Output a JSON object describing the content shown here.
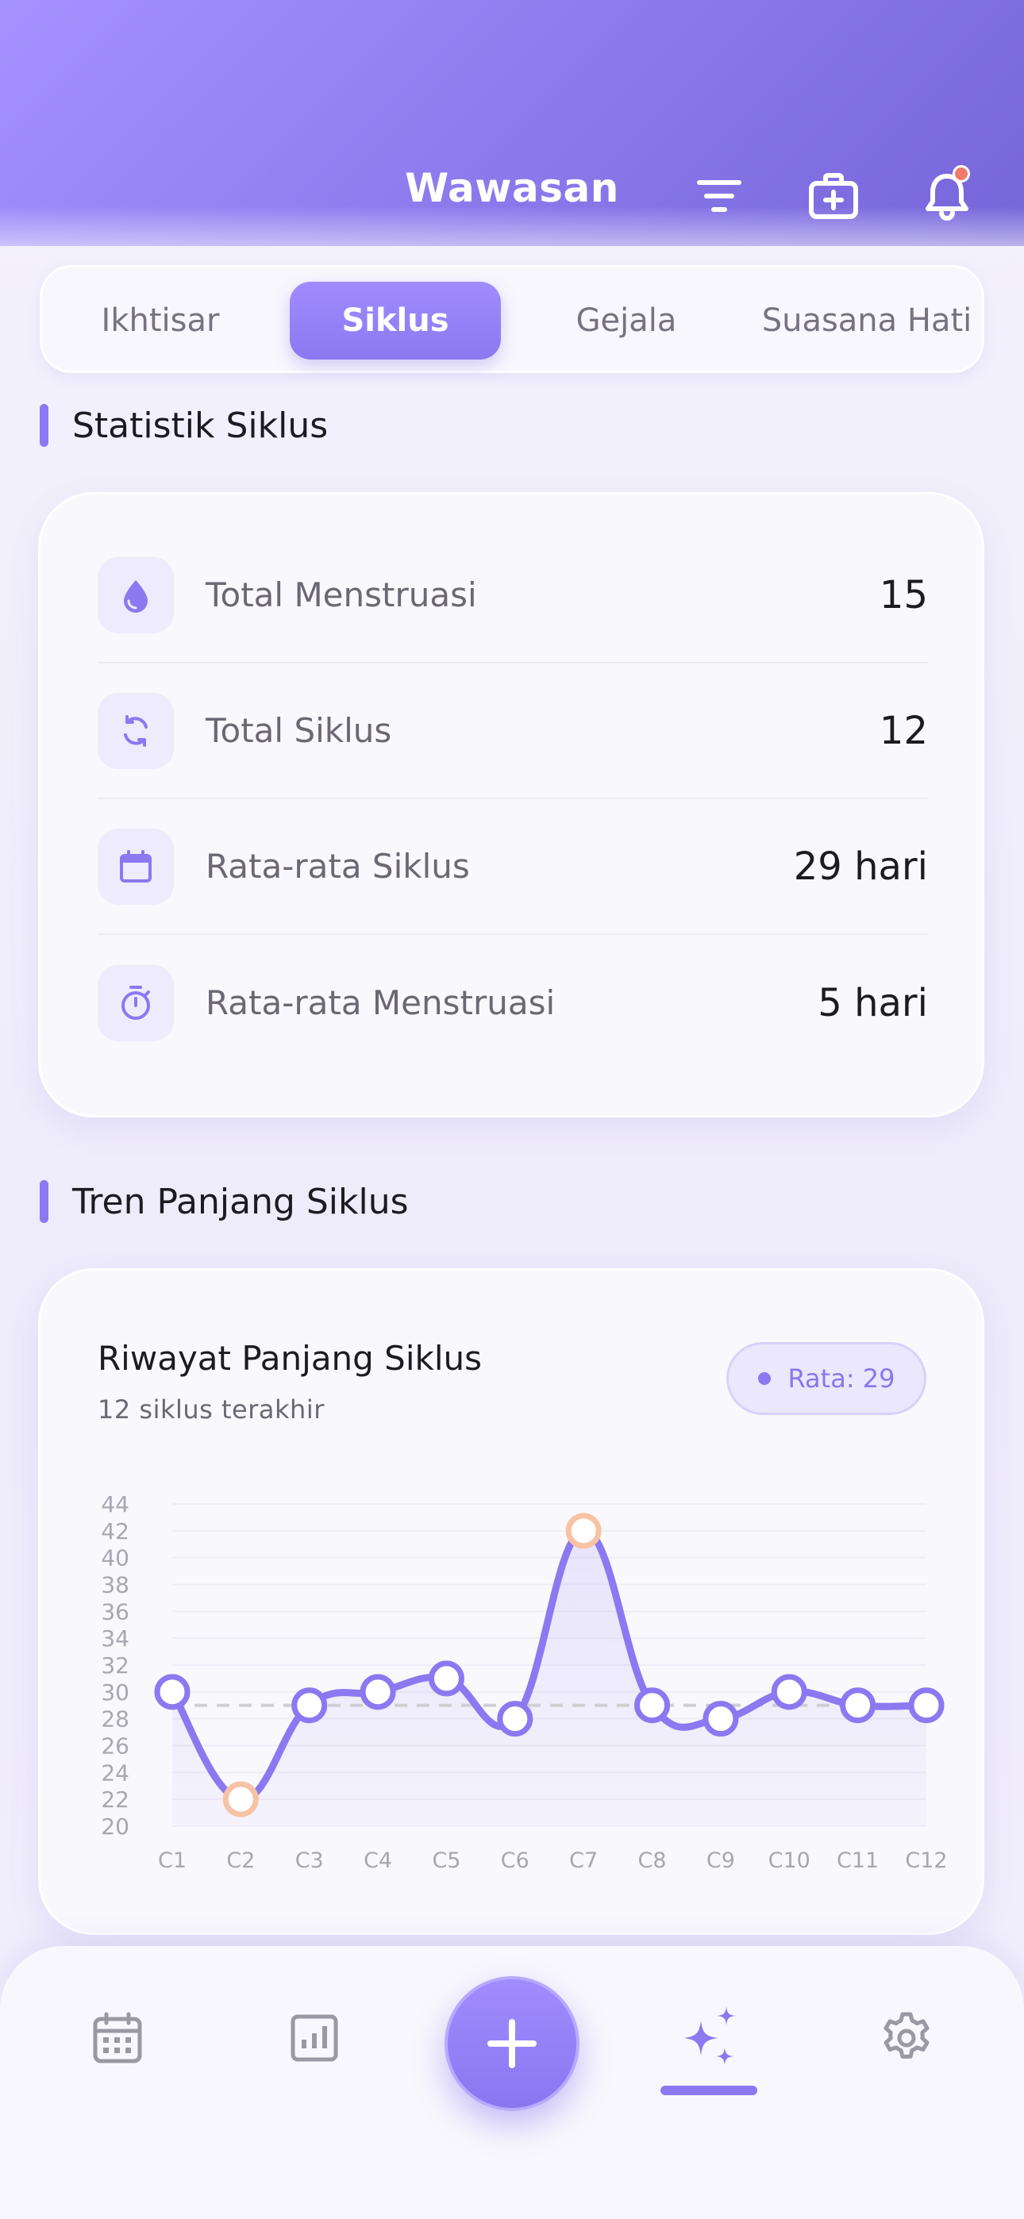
{
  "header": {
    "title": "Wawasan",
    "icons": [
      "filter-icon",
      "first-aid-kit-icon",
      "bell-icon"
    ],
    "has_notification": true
  },
  "tabs": [
    {
      "label": "Ikhtisar",
      "active": false
    },
    {
      "label": "Siklus",
      "active": true
    },
    {
      "label": "Gejala",
      "active": false
    },
    {
      "label": "Suasana Hati",
      "active": false
    }
  ],
  "stats": {
    "section_title": "Statistik Siklus",
    "items": [
      {
        "icon": "drop-icon",
        "label": "Total Menstruasi",
        "value": "15"
      },
      {
        "icon": "cycle-icon",
        "label": "Total Siklus",
        "value": "12"
      },
      {
        "icon": "calendar-icon",
        "label": "Rata-rata Siklus",
        "value": "29 hari"
      },
      {
        "icon": "timer-icon",
        "label": "Rata-rata Menstruasi",
        "value": "5 hari"
      }
    ]
  },
  "trend": {
    "section_title": "Tren Panjang Siklus",
    "card_title": "Riwayat Panjang Siklus",
    "card_subtitle": "12 siklus terakhir",
    "average_label": "Rata: 29"
  },
  "chart_data": {
    "type": "line",
    "title": "Riwayat Panjang Siklus",
    "subtitle": "12 siklus terakhir",
    "categories": [
      "C1",
      "C2",
      "C3",
      "C4",
      "C5",
      "C6",
      "C7",
      "C8",
      "C9",
      "C10",
      "C11",
      "C12"
    ],
    "values": [
      30,
      22,
      29,
      30,
      31,
      28,
      42,
      29,
      28,
      30,
      29,
      29
    ],
    "average": 29,
    "highlighted": [
      "C2",
      "C7"
    ],
    "ylim": [
      20,
      44
    ],
    "yticks": [
      20,
      22,
      24,
      26,
      28,
      30,
      32,
      34,
      36,
      38,
      40,
      42,
      44
    ],
    "grid": true,
    "xlabel": "",
    "ylabel": "",
    "colors": {
      "line": "#8c78f0",
      "highlight": "#f7c3a4",
      "average": "#cfcfd4"
    }
  },
  "bottom_nav": {
    "items": [
      {
        "icon": "calendar-icon",
        "active": false
      },
      {
        "icon": "bar-chart-icon",
        "active": false
      },
      {
        "icon": "plus-icon",
        "active": false
      },
      {
        "icon": "sparkles-icon",
        "active": true
      },
      {
        "icon": "gear-icon",
        "active": false
      }
    ]
  },
  "colors": {
    "accent": "#8c78f0",
    "header_start": "#a592ff",
    "header_end": "#7665d8",
    "notification": "#ef7b6e"
  }
}
